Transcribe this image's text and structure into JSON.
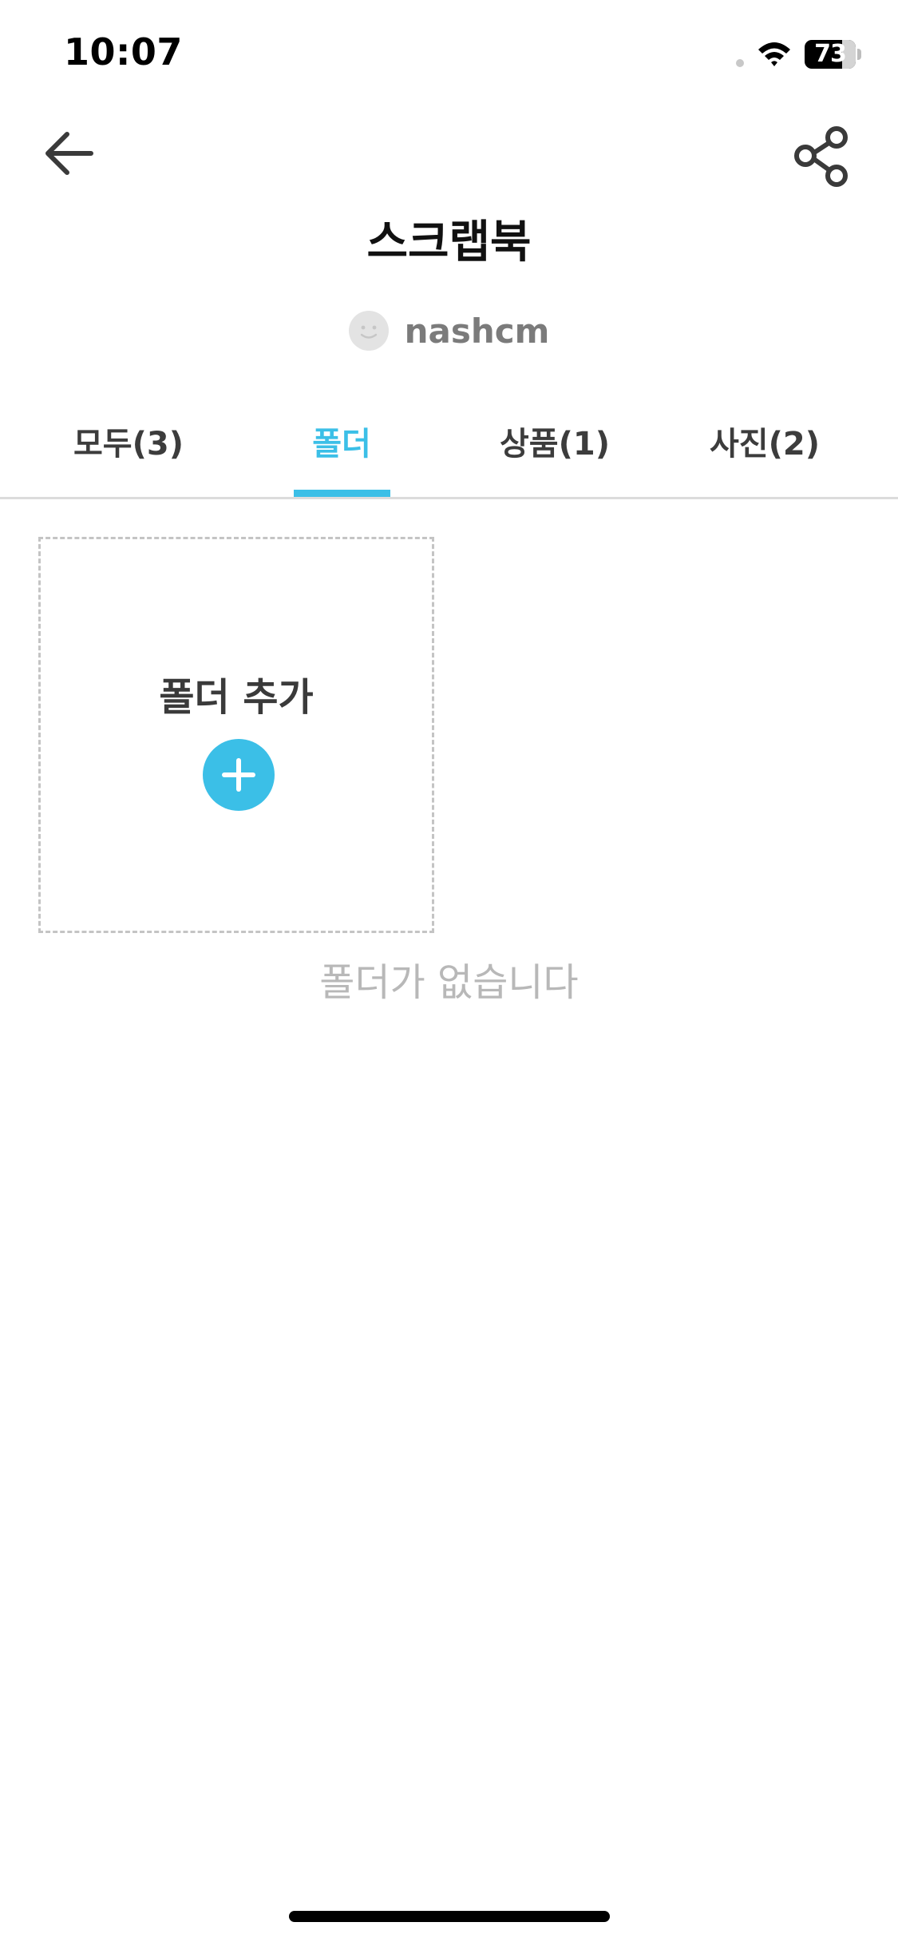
{
  "status_bar": {
    "time": "10:07",
    "battery_percent": 73,
    "battery_label": "73"
  },
  "header": {
    "title": "스크랩북",
    "owner_name": "nashcm",
    "back_icon": "arrow-left-icon",
    "share_icon": "share-icon"
  },
  "tabs": [
    {
      "label": "모두(3)",
      "active": false
    },
    {
      "label": "폴더",
      "active": true
    },
    {
      "label": "상품(1)",
      "active": false
    },
    {
      "label": "사진(2)",
      "active": false
    }
  ],
  "folder_section": {
    "add_folder_label": "폴더 추가",
    "empty_message": "폴더가 없습니다"
  },
  "colors": {
    "accent": "#3bbfe7",
    "tab_text": "#3c3c3c",
    "muted_text": "#b8b8b8",
    "owner_text": "#7b7b7b"
  }
}
